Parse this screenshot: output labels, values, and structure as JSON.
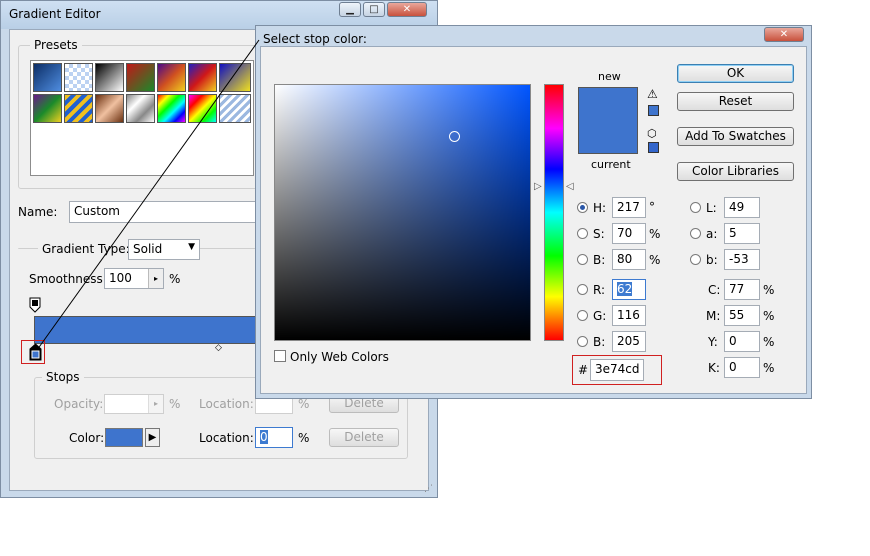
{
  "gradient_editor": {
    "title": "Gradient Editor",
    "presets_label": "Presets",
    "name_label": "Name:",
    "name_value": "Custom",
    "gradient_type_label": "Gradient Type:",
    "gradient_type_value": "Solid",
    "smoothness_label": "Smoothness:",
    "smoothness_value": "100",
    "smoothness_unit": "%",
    "stops_label": "Stops",
    "opacity_label": "Opacity:",
    "opacity_unit": "%",
    "location_label_top": "Location:",
    "location_unit_top": "%",
    "delete_label_top": "Delete",
    "color_label": "Color:",
    "location_label": "Location:",
    "location_value": "0",
    "location_unit": "%",
    "delete_label": "Delete",
    "stop_color": "#3e74cd",
    "presets_colors": [
      [
        "#1c4f9c",
        "#bcd2f2",
        "#000000",
        "#b01818",
        "#7a1a7a",
        "#d01818",
        "#1010c0"
      ],
      [
        "#0a6a1a",
        "#f2c020",
        "#a35a2a",
        "#dadada",
        "#ff2020",
        "#e040c0",
        "#9cb8e0"
      ]
    ]
  },
  "color_picker": {
    "title": "Select stop color:",
    "new_label": "new",
    "current_label": "current",
    "new_color": "#3e74cd",
    "current_color": "#3e74cd",
    "ok_label": "OK",
    "reset_label": "Reset",
    "add_swatches_label": "Add To Swatches",
    "color_libraries_label": "Color Libraries",
    "only_web_colors_label": "Only Web Colors",
    "hsb": {
      "h_label": "H:",
      "h_value": "217",
      "h_unit": "°",
      "s_label": "S:",
      "s_value": "70",
      "s_unit": "%",
      "b_label": "B:",
      "b_value": "80",
      "b_unit": "%"
    },
    "rgb": {
      "r_label": "R:",
      "r_value": "62",
      "g_label": "G:",
      "g_value": "116",
      "b_label": "B:",
      "b_value": "205"
    },
    "lab": {
      "l_label": "L:",
      "l_value": "49",
      "a_label": "a:",
      "a_value": "5",
      "b_label": "b:",
      "b_value": "-53"
    },
    "cmyk": {
      "c_label": "C:",
      "c_value": "77",
      "c_unit": "%",
      "m_label": "M:",
      "m_value": "55",
      "m_unit": "%",
      "y_label": "Y:",
      "y_value": "0",
      "y_unit": "%",
      "k_label": "K:",
      "k_value": "0",
      "k_unit": "%"
    },
    "hex_label": "#",
    "hex_value": "3e74cd"
  },
  "icons": {
    "close": "close-icon",
    "minimize": "minimize-icon",
    "maximize": "maximize-icon",
    "warning": "gamut-warning-icon",
    "web": "web-safe-cube-icon"
  }
}
